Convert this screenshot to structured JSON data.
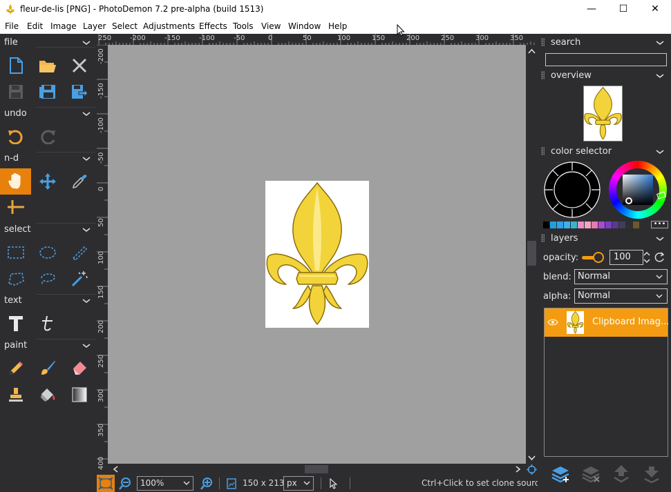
{
  "window": {
    "title": "fleur-de-lis [PNG]  -  PhotoDemon 7.2 pre-alpha (build 1513)",
    "controls": {
      "minimize": "—",
      "maximize": "☐",
      "close": "✕"
    }
  },
  "menu": [
    "File",
    "Edit",
    "Image",
    "Layer",
    "Select",
    "Adjustments",
    "Effects",
    "Tools",
    "View",
    "Window",
    "Help"
  ],
  "toolbox": {
    "sections": {
      "file": "file",
      "undo": "undo",
      "nd": "n-d",
      "select": "select",
      "text": "text",
      "paint": "paint"
    }
  },
  "ruler": {
    "top_labels": [
      "250",
      "-200",
      "-150",
      "-100",
      "-50",
      "0",
      "50",
      "100",
      "150",
      "200",
      "250",
      "300",
      "350"
    ],
    "left_labels": [
      "-200",
      "-150",
      "-100",
      "-50",
      "0",
      "50",
      "100",
      "150",
      "200",
      "250",
      "300",
      "350",
      "400"
    ]
  },
  "image": {
    "name": "fleur-de-lis",
    "width": 150,
    "height": 213
  },
  "statusbar": {
    "zoom": "100%",
    "size": "150 x 213",
    "unit": "px",
    "hint": "Ctrl+Click to set clone source"
  },
  "panels": {
    "search": {
      "title": "search",
      "value": ""
    },
    "overview": {
      "title": "overview"
    },
    "color_selector": {
      "title": "color selector",
      "more": "•••"
    },
    "layers": {
      "title": "layers",
      "opacity_label": "opacity:",
      "opacity_value": "100",
      "blend_label": "blend:",
      "blend_value": "Normal",
      "alpha_label": "alpha:",
      "alpha_value": "Normal",
      "items": [
        {
          "name": "Clipboard Imag..."
        }
      ]
    }
  },
  "colors": {
    "accent": "#f39c12",
    "active_tool": "#e8810b",
    "tool_blue": "#4a9fe4",
    "canvas_bg": "#a0a0a0",
    "panel_bg": "#2d2d30",
    "palette": [
      "#000000",
      "#1ba1e2",
      "#2fa4e7",
      "#3cb0f0",
      "#37b6c9",
      "#e891c5",
      "#f4a3c0",
      "#e57bad",
      "#a94ad8",
      "#7a3fc2",
      "#5b3a8e",
      "#3f3f5a",
      "#2f2f2f",
      "#6b5a2e"
    ]
  }
}
